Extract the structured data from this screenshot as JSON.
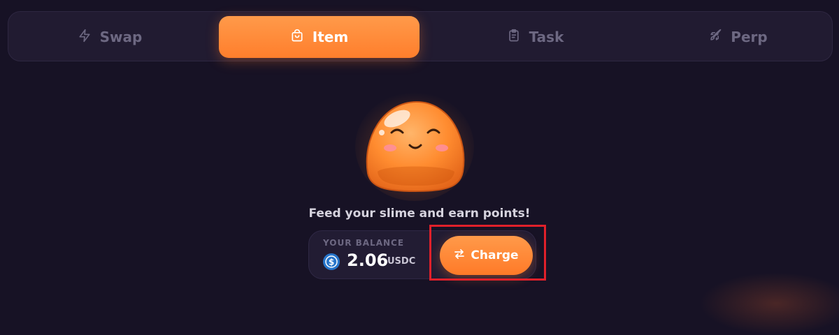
{
  "tabs": [
    {
      "label": "Swap",
      "icon": "lightning-icon",
      "active": false
    },
    {
      "label": "Item",
      "icon": "shopping-bag-icon",
      "active": true
    },
    {
      "label": "Task",
      "icon": "clipboard-icon",
      "active": false
    },
    {
      "label": "Perp",
      "icon": "rocket-icon",
      "active": false
    }
  ],
  "main": {
    "caption": "Feed your slime and earn points!",
    "mascot": "slime-mascot"
  },
  "balance": {
    "label": "YOUR BALANCE",
    "amount": "2.06",
    "unit": "USDC",
    "icon": "usdc-coin-icon"
  },
  "charge_button": {
    "label": "Charge",
    "icon": "swap-arrows-icon"
  },
  "colors": {
    "background": "#171225",
    "accent": "#ff8a3a",
    "highlight": "#e0202a",
    "usdc": "#2775ca"
  }
}
